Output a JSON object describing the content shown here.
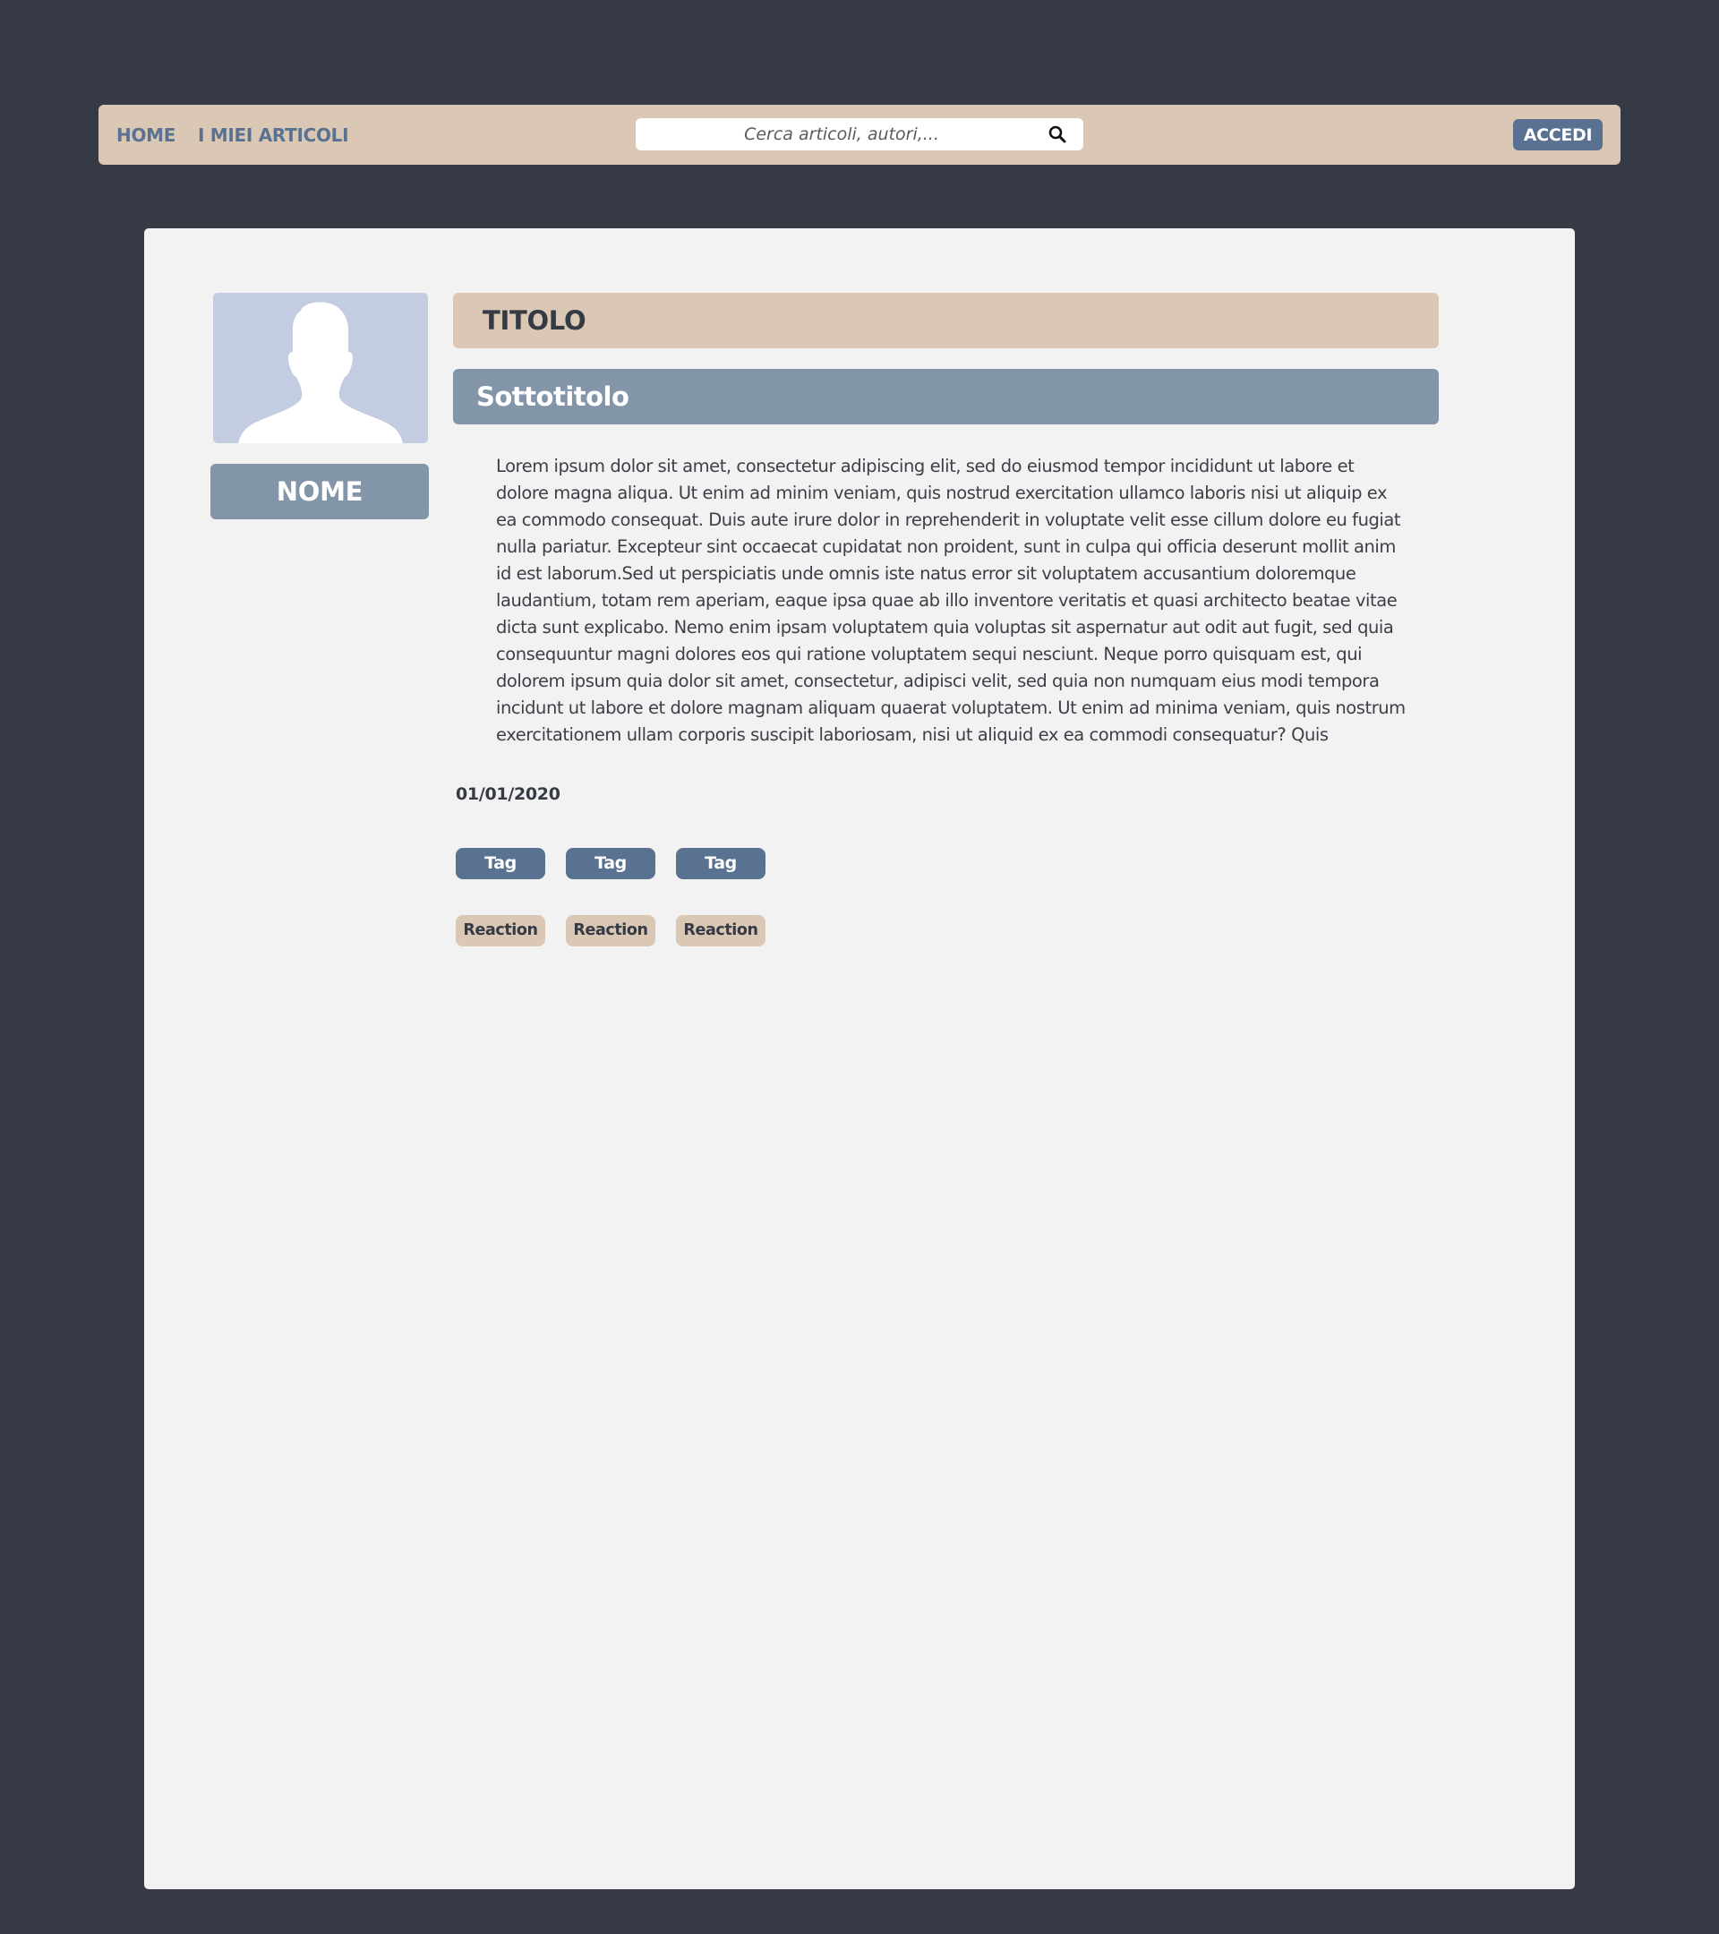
{
  "colors": {
    "page_background": "#353a44",
    "navbar_background": "#dbc8b4",
    "card_background": "#f2f2f2",
    "accent_blue": "#5a7292",
    "muted_blue": "#8396a9",
    "avatar_background": "#c3cce0"
  },
  "nav": {
    "home_label": "HOME",
    "articles_label": "I MIEI ARTICOLI",
    "search": {
      "placeholder": "Cerca articoli, autori,...",
      "value": "",
      "icon": "search-icon"
    },
    "login_label": "ACCEDI"
  },
  "article": {
    "avatar_icon": "user-silhouette-icon",
    "author_name": "NOME",
    "title": "TITOLO",
    "subtitle": "Sottotitolo",
    "body": "Lorem ipsum dolor sit amet, consectetur adipiscing elit, sed do eiusmod tempor incididunt ut labore et dolore magna aliqua. Ut enim ad minim veniam, quis nostrud exercitation ullamco laboris nisi ut aliquip ex ea commodo consequat. Duis aute irure dolor in reprehenderit in voluptate velit esse cillum dolore eu fugiat nulla pariatur. Excepteur sint occaecat cupidatat non proident, sunt in culpa qui officia deserunt mollit anim id est laborum.Sed ut perspiciatis unde omnis iste natus error sit voluptatem accusantium doloremque laudantium, totam rem aperiam, eaque ipsa quae ab illo inventore veritatis et quasi architecto beatae vitae dicta sunt explicabo. Nemo enim ipsam voluptatem quia voluptas sit aspernatur aut odit aut fugit, sed quia consequuntur magni dolores eos qui ratione voluptatem sequi nesciunt. Neque porro quisquam est, qui dolorem ipsum quia dolor sit amet, consectetur, adipisci velit, sed quia non numquam eius modi tempora incidunt ut labore et dolore magnam aliquam quaerat voluptatem. Ut enim ad minima veniam, quis nostrum exercitationem ullam corporis suscipit laboriosam, nisi ut aliquid ex ea commodi consequatur? Quis",
    "date": "01/01/2020",
    "tags": [
      "Tag",
      "Tag",
      "Tag"
    ],
    "reactions": [
      "Reaction",
      "Reaction",
      "Reaction"
    ]
  }
}
